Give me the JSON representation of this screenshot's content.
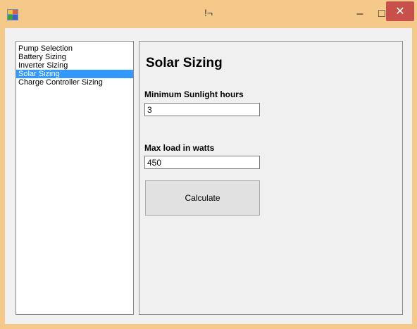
{
  "window": {
    "title": "!¬",
    "minimize_glyph": "–",
    "maximize_glyph": "□",
    "close_glyph": "✕",
    "title_bar_color": "#f5c98a",
    "close_color": "#c7504b"
  },
  "sidebar": {
    "items": [
      {
        "label": "Pump Selection"
      },
      {
        "label": "Battery Sizing"
      },
      {
        "label": "Inverter Sizing"
      },
      {
        "label": "Solar Sizing"
      },
      {
        "label": "Charge Controller Sizing"
      }
    ],
    "selected": "Solar Sizing",
    "selection_color": "#3399ff"
  },
  "main": {
    "title": "Solar Sizing",
    "fields": [
      {
        "label": "Minimum Sunlight hours",
        "value": "3"
      },
      {
        "label": "Max load in watts",
        "value": "450"
      }
    ],
    "calculate_label": "Calculate"
  }
}
